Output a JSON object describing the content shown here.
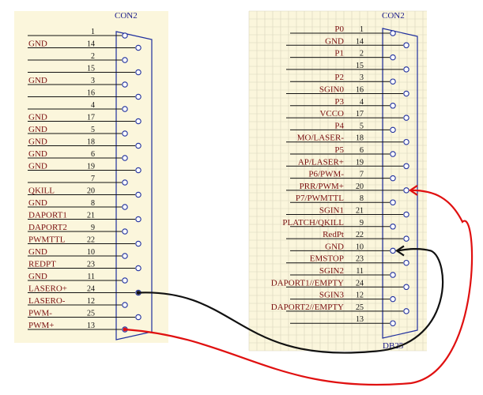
{
  "colors": {
    "panel_left": "#fbf6dc",
    "panel_right": "#fbf6dc",
    "grid": "#d9d3bd",
    "connector": "#1f2f9e",
    "signal_text": "#7a1010",
    "wire_black": "#111111",
    "wire_red": "#e01010"
  },
  "left_connector": {
    "title": "CON2",
    "pins": [
      {
        "pin": "1",
        "signal": ""
      },
      {
        "pin": "14",
        "signal": "GND"
      },
      {
        "pin": "2",
        "signal": ""
      },
      {
        "pin": "15",
        "signal": ""
      },
      {
        "pin": "3",
        "signal": "GND"
      },
      {
        "pin": "16",
        "signal": ""
      },
      {
        "pin": "4",
        "signal": ""
      },
      {
        "pin": "17",
        "signal": "GND"
      },
      {
        "pin": "5",
        "signal": "GND"
      },
      {
        "pin": "18",
        "signal": "GND"
      },
      {
        "pin": "6",
        "signal": "GND"
      },
      {
        "pin": "19",
        "signal": "GND"
      },
      {
        "pin": "7",
        "signal": ""
      },
      {
        "pin": "20",
        "signal": "QKILL"
      },
      {
        "pin": "8",
        "signal": "GND"
      },
      {
        "pin": "21",
        "signal": "DAPORT1"
      },
      {
        "pin": "9",
        "signal": "DAPORT2"
      },
      {
        "pin": "22",
        "signal": "PWMTTL"
      },
      {
        "pin": "10",
        "signal": "GND"
      },
      {
        "pin": "23",
        "signal": "REDPT"
      },
      {
        "pin": "11",
        "signal": "GND"
      },
      {
        "pin": "24",
        "signal": "LASERO+"
      },
      {
        "pin": "12",
        "signal": "LASERO-"
      },
      {
        "pin": "25",
        "signal": "PWM-"
      },
      {
        "pin": "13",
        "signal": "PWM+"
      }
    ]
  },
  "right_connector": {
    "title": "CON2",
    "footer": "DB25",
    "pins": [
      {
        "pin": "1",
        "signal": "P0"
      },
      {
        "pin": "14",
        "signal": "GND"
      },
      {
        "pin": "2",
        "signal": "P1"
      },
      {
        "pin": "15",
        "signal": ""
      },
      {
        "pin": "3",
        "signal": "P2"
      },
      {
        "pin": "16",
        "signal": "SGIN0"
      },
      {
        "pin": "4",
        "signal": "P3"
      },
      {
        "pin": "17",
        "signal": "VCCO"
      },
      {
        "pin": "5",
        "signal": "P4"
      },
      {
        "pin": "18",
        "signal": "MO/LASER-"
      },
      {
        "pin": "6",
        "signal": "P5"
      },
      {
        "pin": "19",
        "signal": "AP/LASER+"
      },
      {
        "pin": "7",
        "signal": "P6/PWM-"
      },
      {
        "pin": "20",
        "signal": "PRR/PWM+"
      },
      {
        "pin": "8",
        "signal": "P7/PWMTTL"
      },
      {
        "pin": "21",
        "signal": "SGIN1"
      },
      {
        "pin": "9",
        "signal": "PLATCH/QKILL"
      },
      {
        "pin": "22",
        "signal": "RedPt"
      },
      {
        "pin": "10",
        "signal": "GND"
      },
      {
        "pin": "23",
        "signal": "EMSTOP"
      },
      {
        "pin": "11",
        "signal": "SGIN2"
      },
      {
        "pin": "24",
        "signal": "DAPORT1//EMPTY"
      },
      {
        "pin": "12",
        "signal": "SGIN3"
      },
      {
        "pin": "25",
        "signal": "DAPORT2//EMPTY"
      },
      {
        "pin": "13",
        "signal": ""
      }
    ]
  },
  "connections": [
    {
      "from_pin": "24",
      "from_signal": "LASERO+",
      "to_pin": "10",
      "to_signal": "GND",
      "wire": "black"
    },
    {
      "from_pin": "13",
      "from_signal": "PWM+",
      "to_pin": "20",
      "to_signal": "PRR/PWM+",
      "wire": "red"
    }
  ]
}
